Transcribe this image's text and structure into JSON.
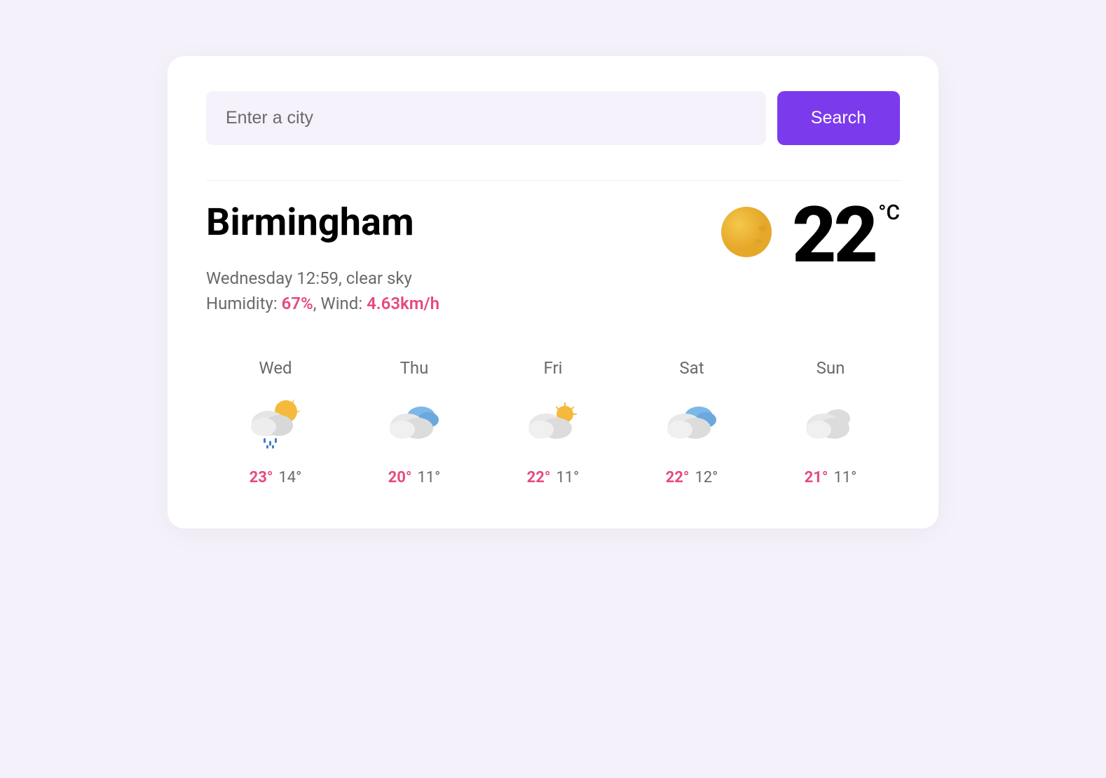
{
  "search": {
    "placeholder": "Enter a city",
    "button_label": "Search"
  },
  "current": {
    "city": "Birmingham",
    "datetime_condition": "Wednesday 12:59, clear sky",
    "humidity_label": "Humidity: ",
    "humidity_value": "67%",
    "wind_separator": ", Wind: ",
    "wind_value": "4.63km/h",
    "temp": "22",
    "unit": "°C",
    "icon": "clear-sun"
  },
  "forecast": [
    {
      "day": "Wed",
      "icon": "rain-sun",
      "high": "23°",
      "low": "14°"
    },
    {
      "day": "Thu",
      "icon": "cloudy-blue",
      "high": "20°",
      "low": "11°"
    },
    {
      "day": "Fri",
      "icon": "partly-sunny",
      "high": "22°",
      "low": "11°"
    },
    {
      "day": "Sat",
      "icon": "cloudy-blue",
      "high": "22°",
      "low": "12°"
    },
    {
      "day": "Sun",
      "icon": "cloudy",
      "high": "21°",
      "low": "11°"
    }
  ]
}
